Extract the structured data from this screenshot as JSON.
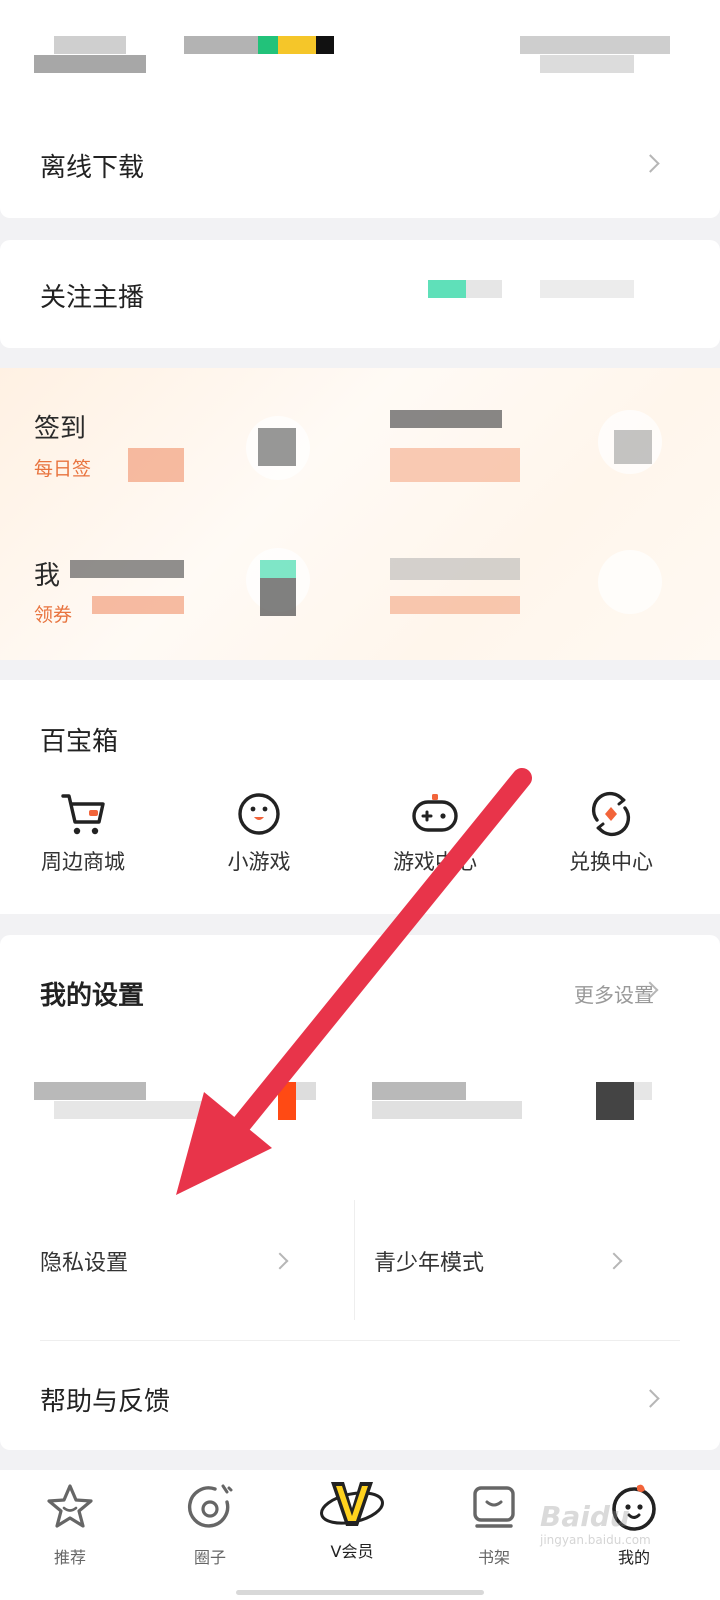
{
  "offline": {
    "label": "离线下载"
  },
  "follow": {
    "label": "关注主播"
  },
  "tasks": {
    "checkin_title": "签到",
    "checkin_sub": "每日签",
    "my_title": "我",
    "coupon_sub": "领券"
  },
  "treasure_box": {
    "title": "百宝箱",
    "tools": [
      {
        "label": "周边商城",
        "icon": "cart-icon"
      },
      {
        "label": "小游戏",
        "icon": "penguin-icon"
      },
      {
        "label": "游戏中心",
        "icon": "gamepad-icon"
      },
      {
        "label": "兑换中心",
        "icon": "exchange-icon"
      }
    ]
  },
  "settings": {
    "title": "我的设置",
    "more": "更多设置",
    "privacy": "隐私设置",
    "teen_mode": "青少年模式",
    "help": "帮助与反馈"
  },
  "tabs": [
    {
      "label": "推荐",
      "icon": "star-icon"
    },
    {
      "label": "圈子",
      "icon": "circle-icon"
    },
    {
      "label": "V会员",
      "icon": "vip-icon",
      "active": true
    },
    {
      "label": "书架",
      "icon": "bookshelf-icon"
    },
    {
      "label": "我的",
      "icon": "profile-icon",
      "active": true
    }
  ],
  "watermark": {
    "brand": "Baidu",
    "site": "jingyan.baidu.com"
  },
  "colors": {
    "accent_orange": "#e8743f",
    "arrow_red": "#e8344a",
    "vip_yellow": "#ffd21e"
  }
}
